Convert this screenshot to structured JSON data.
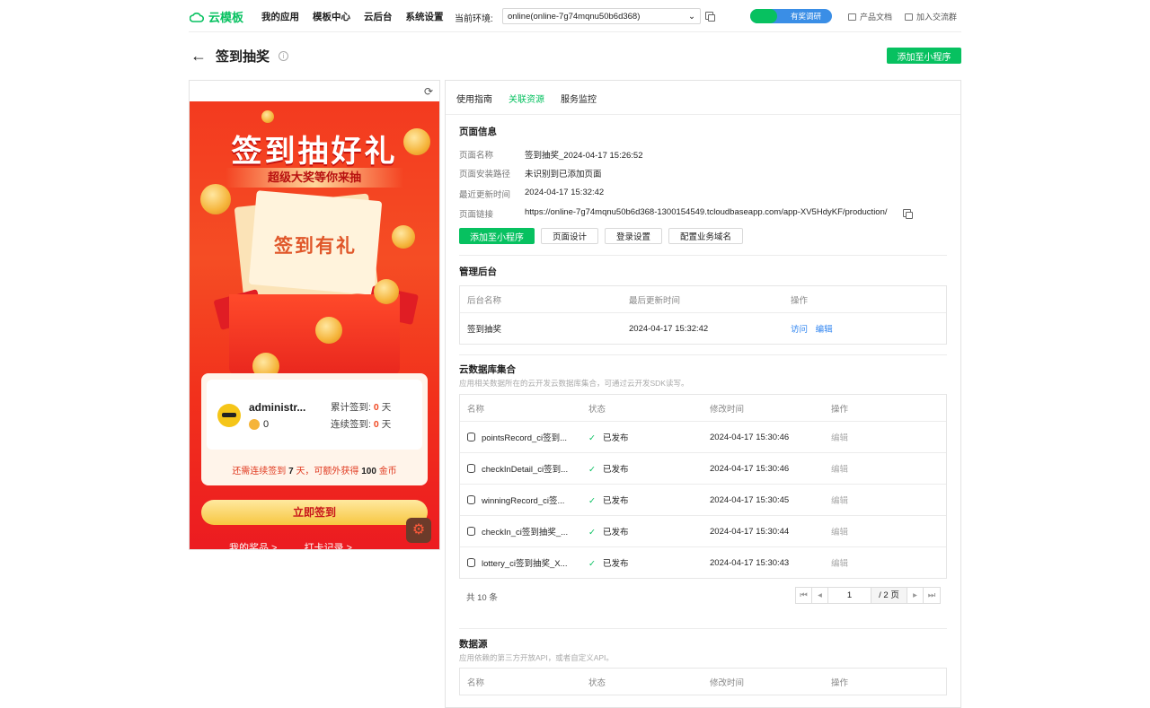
{
  "topbar": {
    "logo": "云模板",
    "nav": [
      "我的应用",
      "模板中心",
      "云后台",
      "系统设置"
    ],
    "env_label": "当前环境:",
    "env_value": "online(online-7g74mqnu50b6d368)",
    "promo": "有奖调研",
    "links": [
      "产品文档",
      "加入交流群"
    ]
  },
  "page": {
    "title": "签到抽奖",
    "add_button": "添加至小程序"
  },
  "phone": {
    "hero_title": "签到抽好礼",
    "hero_sub": "超级大奖等你来抽",
    "ticket_text": "签到有礼",
    "username": "administr...",
    "points": "0",
    "stats": [
      {
        "label": "累计签到:",
        "value": "0",
        "unit": "天"
      },
      {
        "label": "连续签到:",
        "value": "0",
        "unit": "天"
      }
    ],
    "note_pre": "还需连续签到",
    "note_days": "7",
    "note_mid": "天，可额外获得",
    "note_coins": "100",
    "note_post": "金币",
    "signin": "立即签到",
    "bottom_links": [
      "我的奖品 >",
      "打卡记录 >"
    ]
  },
  "panel": {
    "tabs": [
      "使用指南",
      "关联资源",
      "服务监控"
    ],
    "page_info": {
      "title": "页面信息",
      "rows": [
        {
          "k": "页面名称",
          "v": "签到抽奖_2024-04-17 15:26:52"
        },
        {
          "k": "页面安装路径",
          "v": "未识别到已添加页面"
        },
        {
          "k": "最近更新时间",
          "v": "2024-04-17 15:32:42"
        },
        {
          "k": "页面链接",
          "v": "https://online-7g74mqnu50b6d368-1300154549.tcloudbaseapp.com/app-XV5HdyKF/production/"
        }
      ],
      "buttons": [
        "添加至小程序",
        "页面设计",
        "登录设置",
        "配置业务域名"
      ]
    },
    "admin": {
      "title": "管理后台",
      "headers": [
        "后台名称",
        "最后更新时间",
        "操作"
      ],
      "row": {
        "name": "签到抽奖",
        "time": "2024-04-17 15:32:42",
        "visit": "访问",
        "edit": "编辑"
      }
    },
    "db": {
      "title": "云数据库集合",
      "desc": "应用相关数据所在的云开发云数据库集合，可通过云开发SDK读写。",
      "headers": [
        "名称",
        "状态",
        "修改时间",
        "操作"
      ],
      "rows": [
        {
          "name": "pointsRecord_ci签到...",
          "status": "已发布",
          "time": "2024-04-17 15:30:46",
          "op": "编辑"
        },
        {
          "name": "checkInDetail_ci签到...",
          "status": "已发布",
          "time": "2024-04-17 15:30:46",
          "op": "编辑"
        },
        {
          "name": "winningRecord_ci签...",
          "status": "已发布",
          "time": "2024-04-17 15:30:45",
          "op": "编辑"
        },
        {
          "name": "checkIn_ci签到抽奖_...",
          "status": "已发布",
          "time": "2024-04-17 15:30:44",
          "op": "编辑"
        },
        {
          "name": "lottery_ci签到抽奖_X...",
          "status": "已发布",
          "time": "2024-04-17 15:30:43",
          "op": "编辑"
        }
      ],
      "total": "共 10 条",
      "page": "1",
      "page_total": "/ 2 页"
    },
    "datasource": {
      "title": "数据源",
      "desc": "应用依赖的第三方开放API，或者自定义API。",
      "headers": [
        "名称",
        "状态",
        "修改时间",
        "操作"
      ]
    }
  },
  "colors": {
    "accent": "#07c160",
    "link": "#2f84f0",
    "hero_red": "#f33a1f"
  }
}
